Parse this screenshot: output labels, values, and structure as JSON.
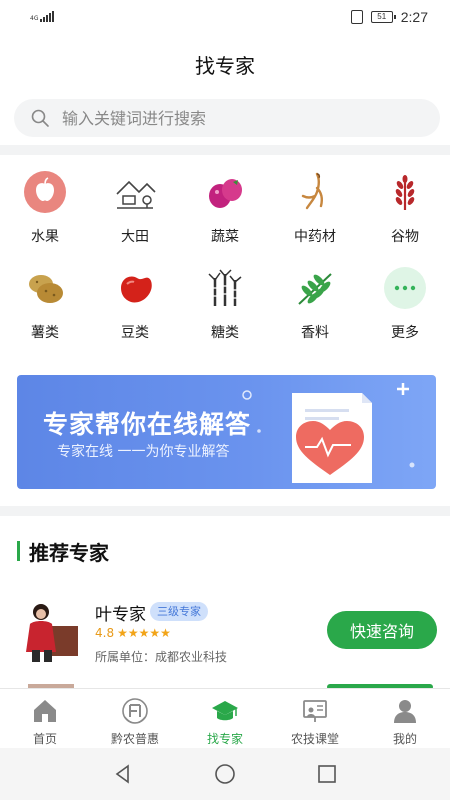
{
  "status_bar": {
    "network": "4G",
    "battery": "51",
    "time": "2:27"
  },
  "header": {
    "title": "找专家"
  },
  "search": {
    "placeholder": "输入关键词进行搜索"
  },
  "categories": [
    {
      "label": "水果",
      "icon": "apple-icon"
    },
    {
      "label": "大田",
      "icon": "farm-field-icon"
    },
    {
      "label": "蔬菜",
      "icon": "eggplant-icon"
    },
    {
      "label": "中药材",
      "icon": "ginseng-root-icon"
    },
    {
      "label": "谷物",
      "icon": "wheat-icon"
    },
    {
      "label": "薯类",
      "icon": "potato-icon"
    },
    {
      "label": "豆类",
      "icon": "bean-icon"
    },
    {
      "label": "糖类",
      "icon": "sugarcane-icon"
    },
    {
      "label": "香料",
      "icon": "herb-leaf-icon"
    },
    {
      "label": "更多",
      "icon": "more-dots-icon"
    }
  ],
  "banner": {
    "title": "专家帮你在线解答",
    "subtitle": "专家在线 一一为你专业解答"
  },
  "section": {
    "title": "推荐专家"
  },
  "expert": {
    "name": "叶专家",
    "badge": "三级专家",
    "rating": "4.8",
    "stars": "★★★★★",
    "unit": "所属单位：成都农业科技",
    "consult_label": "快速咨询"
  },
  "tabs": [
    {
      "label": "首页",
      "icon": "home-icon",
      "active": false
    },
    {
      "label": "黔农普惠",
      "icon": "qiannong-logo-icon",
      "active": false
    },
    {
      "label": "找专家",
      "icon": "graduation-cap-icon",
      "active": true
    },
    {
      "label": "农技课堂",
      "icon": "classroom-icon",
      "active": false
    },
    {
      "label": "我的",
      "icon": "user-icon",
      "active": false
    }
  ],
  "colors": {
    "accent": "#2aa84a",
    "banner": "#6a93ee",
    "badge_bg": "#cfe0fb",
    "star": "#f2a418"
  }
}
